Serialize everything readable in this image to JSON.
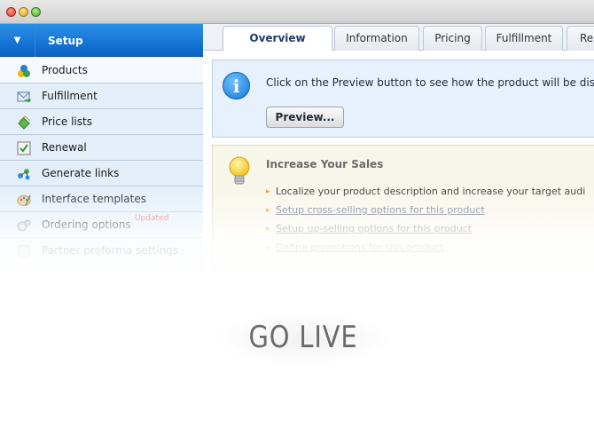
{
  "sidebar": {
    "header": {
      "label": "Setup"
    },
    "items": [
      {
        "label": "Products",
        "icon": "products-icon",
        "active": true
      },
      {
        "label": "Fulfillment",
        "icon": "fulfillment-icon"
      },
      {
        "label": "Price lists",
        "icon": "price-lists-icon"
      },
      {
        "label": "Renewal",
        "icon": "renewal-icon"
      },
      {
        "label": "Generate links",
        "icon": "generate-links-icon"
      },
      {
        "label": "Interface templates",
        "icon": "interface-templates-icon"
      },
      {
        "label": "Ordering options",
        "icon": "ordering-options-icon",
        "badge": "Updated"
      },
      {
        "label": "Partner proforma settings",
        "icon": "partner-proforma-icon"
      }
    ]
  },
  "tabs": [
    {
      "label": "Overview",
      "active": true
    },
    {
      "label": "Information"
    },
    {
      "label": "Pricing"
    },
    {
      "label": "Fulfillment"
    },
    {
      "label": "Re"
    }
  ],
  "info": {
    "text": "Click on the Preview button to see how the product will be displa",
    "preview_label": "Preview..."
  },
  "sales": {
    "title": "Increase Your Sales",
    "items": [
      "Localize your product description and increase your target audi",
      "Setup cross-selling options for this product",
      "Setup up-selling options for this product",
      "Define promotions for this product"
    ]
  },
  "overlay": {
    "cta": "GO LIVE"
  },
  "colors": {
    "setup_bar": "#0a62c6",
    "badge": "#e05a4a",
    "bullet": "#e0a020"
  }
}
